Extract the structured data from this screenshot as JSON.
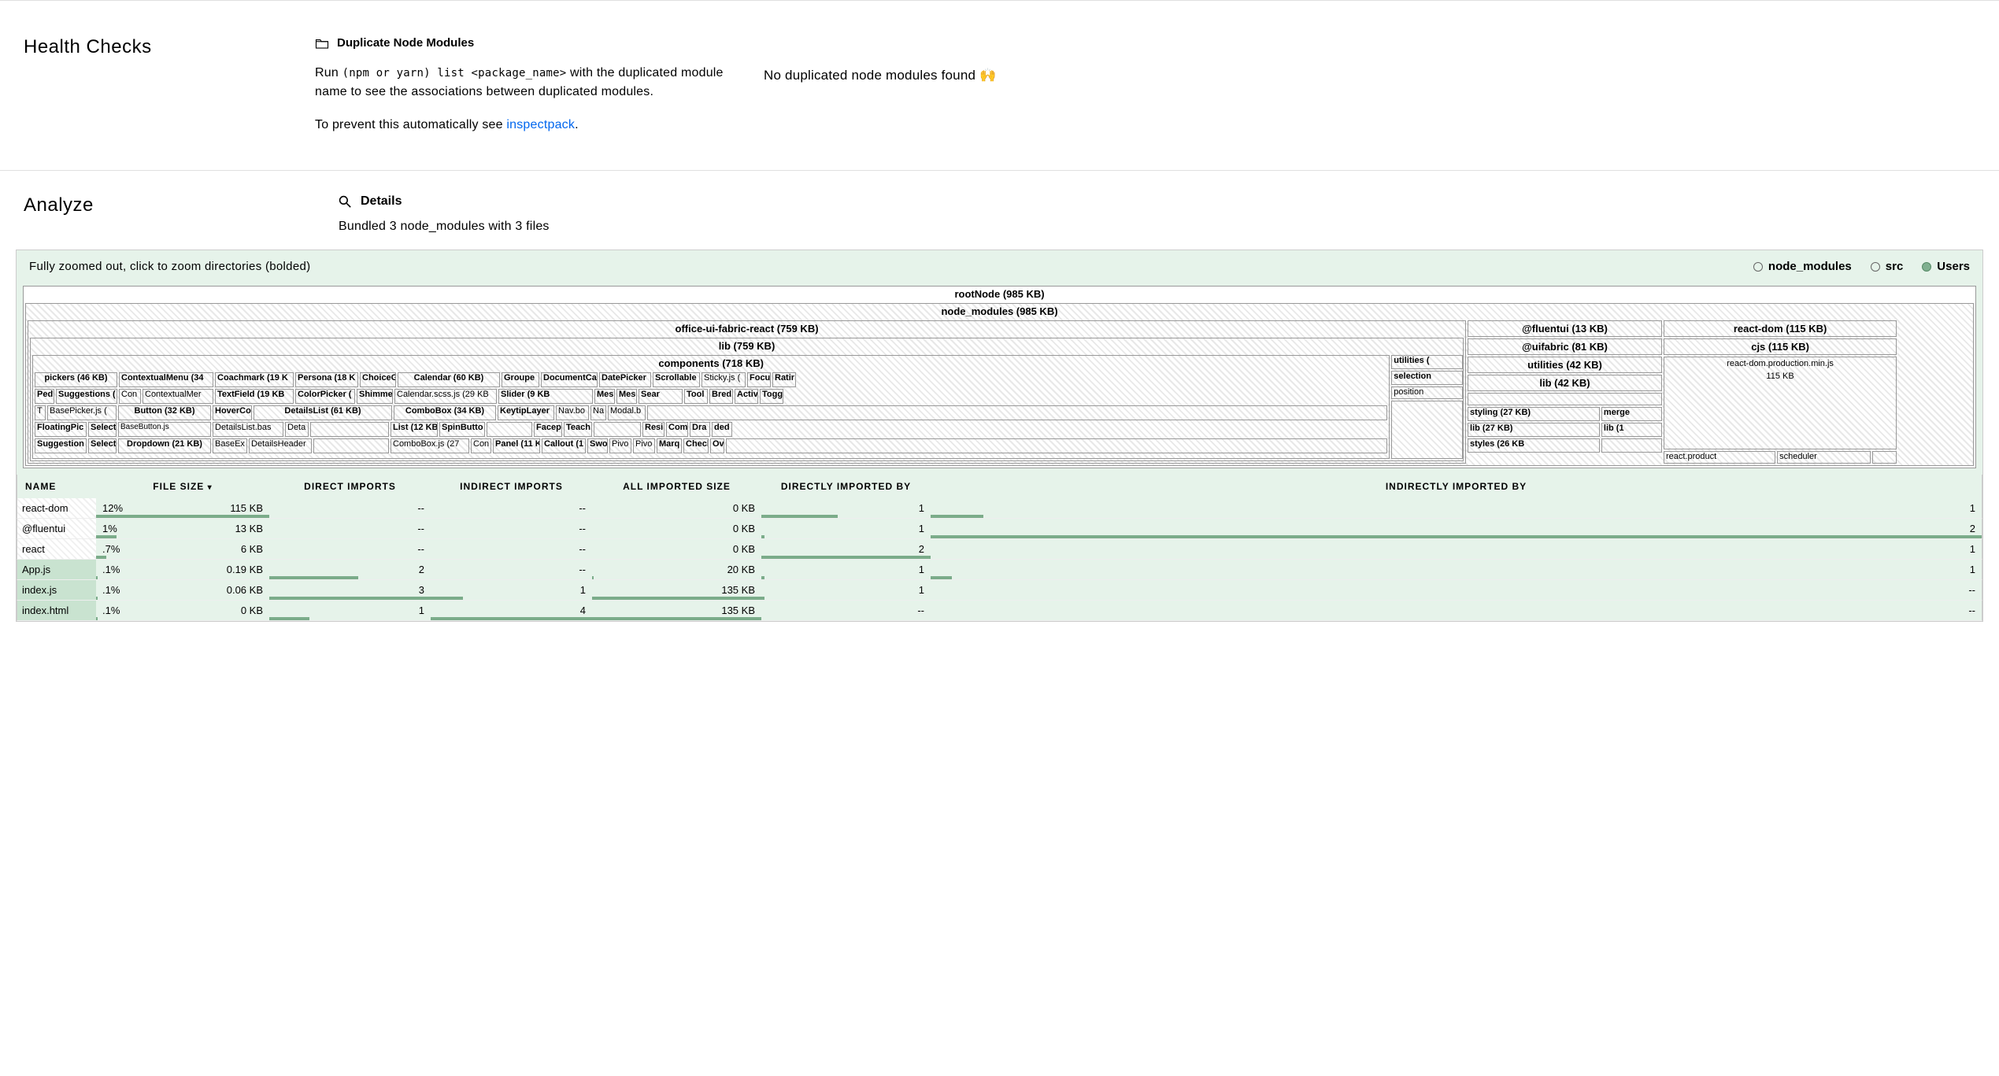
{
  "healthChecks": {
    "sectionTitle": "Health Checks",
    "headingLabel": "Duplicate Node Modules",
    "descPrefix": "Run ",
    "descCode": "(npm or yarn) list <package_name>",
    "descSuffix": " with the duplicated module name to see the associations between duplicated modules.",
    "preventPrefix": "To prevent this automatically see ",
    "preventLink": "inspectpack",
    "preventSuffix": ".",
    "resultText": "No duplicated node modules found 🙌"
  },
  "analyze": {
    "sectionTitle": "Analyze",
    "headingLabel": "Details",
    "subText": "Bundled 3 node_modules with 3 files"
  },
  "treemapPanel": {
    "zoomHint": "Fully zoomed out, click to zoom directories (bolded)",
    "legend": [
      {
        "label": "node_modules",
        "filled": false
      },
      {
        "label": "src",
        "filled": false
      },
      {
        "label": "Users",
        "filled": true
      }
    ],
    "root": {
      "label": "rootNode (985 KB)",
      "nodeModules": {
        "label": "node_modules (985 KB)",
        "ouf": {
          "label": "office-ui-fabric-react (759 KB)",
          "lib": {
            "label": "lib (759 KB)",
            "components": {
              "label": "components (718 KB)",
              "pickers": "pickers (46 KB)",
              "contextualMenu": "ContextualMenu (34",
              "coachmark": "Coachmark (19 K",
              "persona": "Persona (18 K",
              "choice": "ChoiceG",
              "calendar": "Calendar (60 KB)",
              "calendarScss": "Calendar.scss.js (29 KB",
              "groupe": "Groupe",
              "document": "DocumentCa",
              "datePicker": "DatePicker",
              "scrollable": "Scrollable",
              "sticky": "Sticky.js (",
              "focu": "Focu",
              "ratir": "Ratir",
              "ped": "Ped",
              "suggestions": "Suggestions (",
              "con": "Con",
              "contextualMer": "ContextualMer",
              "textField": "TextField (19 KB",
              "colorPicker": "ColorPicker (",
              "shimmer": "Shimme",
              "slider": "Slider (9 KB",
              "mes1": "Mes",
              "mes2": "Mes",
              "sear": "Sear",
              "tBase": "T",
              "basePicker": "BasePicker.js (",
              "button": "Button (32 KB)",
              "hoverCo": "HoverCo",
              "detailsList": "DetailsList (61 KB)",
              "keytip": "KeytipLayer",
              "navbo": "Nav.bo",
              "na": "Na",
              "modalb": "Modal.b",
              "tool": "Tool",
              "bred": "Bred",
              "activ": "Activ",
              "togg": "Togg",
              "floatingPic": "FloatingPic",
              "select1": "Select",
              "baseButton": "BaseButton.js",
              "detailsListBas": "DetailsList.bas",
              "deta": "Deta",
              "comboBox": "ComboBox (34 KB)",
              "list": "List (12 KB",
              "spinButto": "SpinButto",
              "facep": "Facep",
              "teach": "Teach",
              "selection": "selection",
              "suggestion": "Suggestion",
              "select2": "Select",
              "dropdown": "Dropdown (21 KB)",
              "baseEx": "BaseEx",
              "detailsHeader": "DetailsHeader",
              "comboBoxJs": "ComboBox.js (27",
              "con2": "Con",
              "panel": "Panel (11 K",
              "callout": "Callout (1",
              "swo": "Swo",
              "pivo1": "Pivo",
              "pivo2": "Pivo",
              "marq": "Marq",
              "checl": "Checl",
              "resi": "Resi",
              "com": "Com",
              "dra": "Dra",
              "ded": "ded",
              "ov": "Ov"
            },
            "utilities": "utilities ("
          }
        },
        "fluentui": {
          "label": "@fluentui (13 KB)",
          "uifabric": "@uifabric (81 KB)",
          "utilities": "utilities (42 KB)",
          "lib42": "lib (42 KB)",
          "styling27": "styling (27 KB)",
          "merge": "merge",
          "lib27": "lib (27 KB)",
          "lib10": "lib (1",
          "styles26": "styles (26 KB",
          "position": "position"
        },
        "reactDom": {
          "label": "react-dom (115 KB)",
          "cjs": "cjs (115 KB)",
          "prodMin": "react-dom.production.min.js",
          "size": "115 KB",
          "reactProduct": "react.product",
          "scheduler": "scheduler"
        }
      }
    }
  },
  "table": {
    "headers": {
      "name": "NAME",
      "fileSize": "FILE SIZE",
      "directImports": "DIRECT IMPORTS",
      "indirectImports": "INDIRECT IMPORTS",
      "allImportedSize": "ALL IMPORTED SIZE",
      "directlyImportedBy": "DIRECTLY IMPORTED BY",
      "indirectlyImportedBy": "INDIRECTLY IMPORTED BY"
    },
    "rows": [
      {
        "name": "react-dom",
        "src": false,
        "pct": "12%",
        "size": "115 KB",
        "sizeBar": 100,
        "di": "--",
        "ii": "--",
        "ais": "0 KB",
        "dib": "1",
        "dibBar": 45,
        "iib": "1",
        "iibBar": 5
      },
      {
        "name": "@fluentui",
        "src": false,
        "pct": "1%",
        "size": "13 KB",
        "sizeBar": 12,
        "di": "--",
        "ii": "--",
        "ais": "0 KB",
        "dib": "1",
        "dibBar": 2,
        "iib": "2",
        "iibBar": 100
      },
      {
        "name": "react",
        "src": false,
        "pct": ".7%",
        "size": "6 KB",
        "sizeBar": 6,
        "di": "--",
        "ii": "--",
        "ais": "0 KB",
        "dib": "2",
        "dibBar": 100,
        "iib": "1",
        "iibBar": 0
      },
      {
        "name": "App.js",
        "src": true,
        "pct": ".1%",
        "size": "0.19 KB",
        "sizeBar": 1,
        "di": "2",
        "diBar": 55,
        "ii": "--",
        "ais": "20 KB",
        "aisBar": 1,
        "dib": "1",
        "dibBar": 2,
        "iib": "1",
        "iibBar": 2
      },
      {
        "name": "index.js",
        "src": true,
        "pct": ".1%",
        "size": "0.06 KB",
        "sizeBar": 1,
        "di": "3",
        "diBar": 100,
        "ii": "1",
        "iiBar": 20,
        "ais": "135 KB",
        "aisBar": 100,
        "dib": "1",
        "dibBar": 2,
        "iib": "--"
      },
      {
        "name": "index.html",
        "src": true,
        "pct": ".1%",
        "size": "0 KB",
        "sizeBar": 1,
        "di": "1",
        "diBar": 25,
        "ii": "4",
        "iiBar": 100,
        "ais": "135 KB",
        "aisBar": 100,
        "dib": "--",
        "iib": "--"
      }
    ]
  }
}
